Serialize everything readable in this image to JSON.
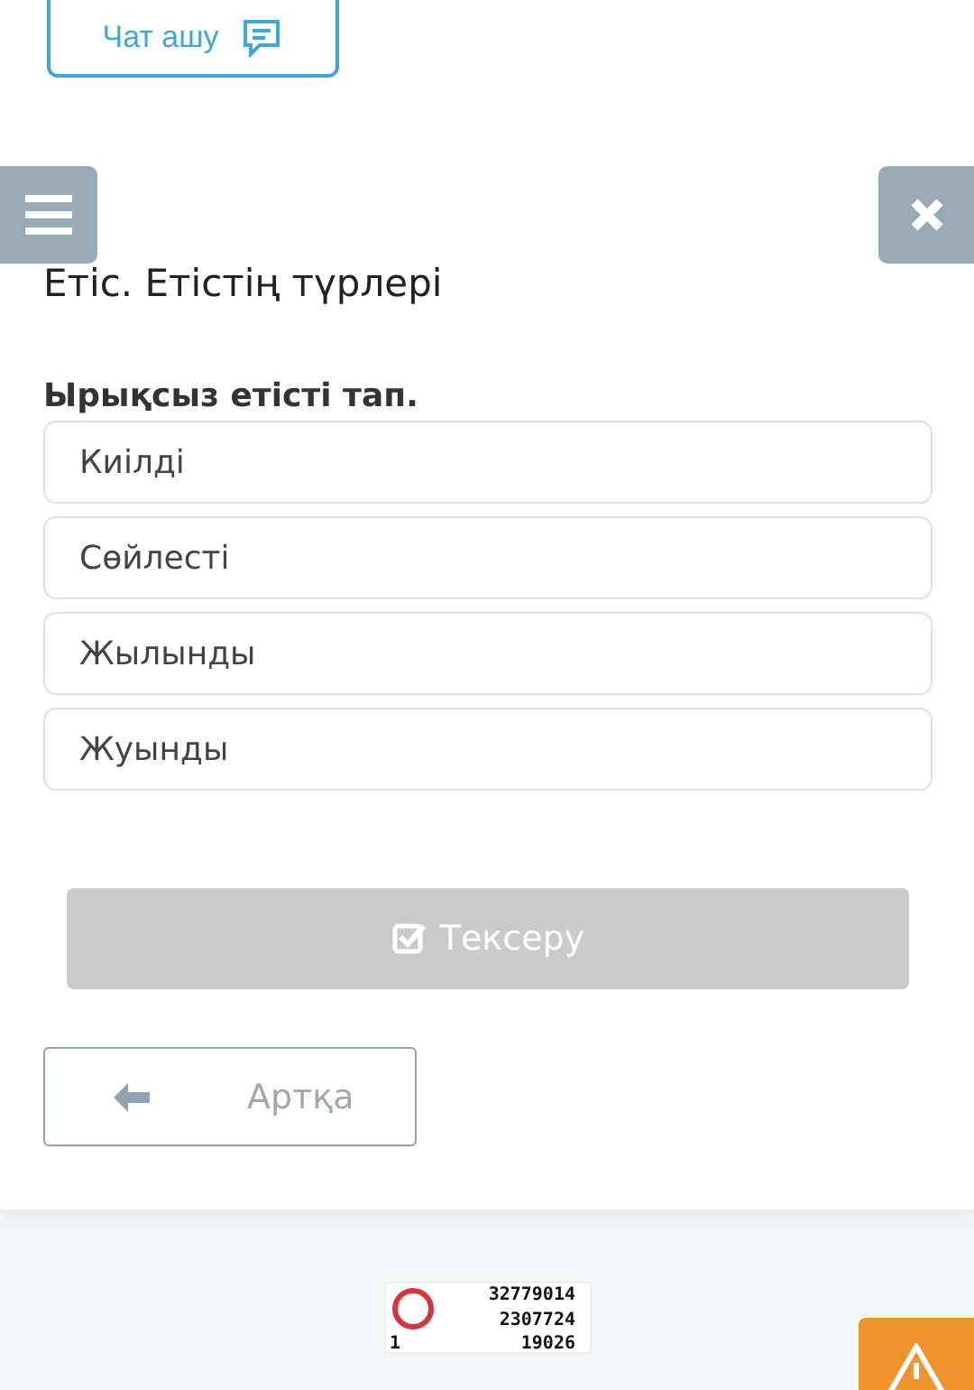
{
  "chat_button": {
    "label": "Чат ашу"
  },
  "title": "Етіс. Етістің түрлері",
  "question": "Ырықсыз етісті тап.",
  "options": [
    {
      "label": "Киілді",
      "selected": false
    },
    {
      "label": "Сөйлесті",
      "selected": false
    },
    {
      "label": "Жылынды",
      "selected": false
    },
    {
      "label": "Жуынды",
      "selected": false
    }
  ],
  "check_button": {
    "label": "Тексеру",
    "disabled": true
  },
  "back_button": {
    "label": "Артқа"
  },
  "counter": {
    "total": "32779014",
    "today": "2307724",
    "online": "1",
    "visits": "19026"
  }
}
